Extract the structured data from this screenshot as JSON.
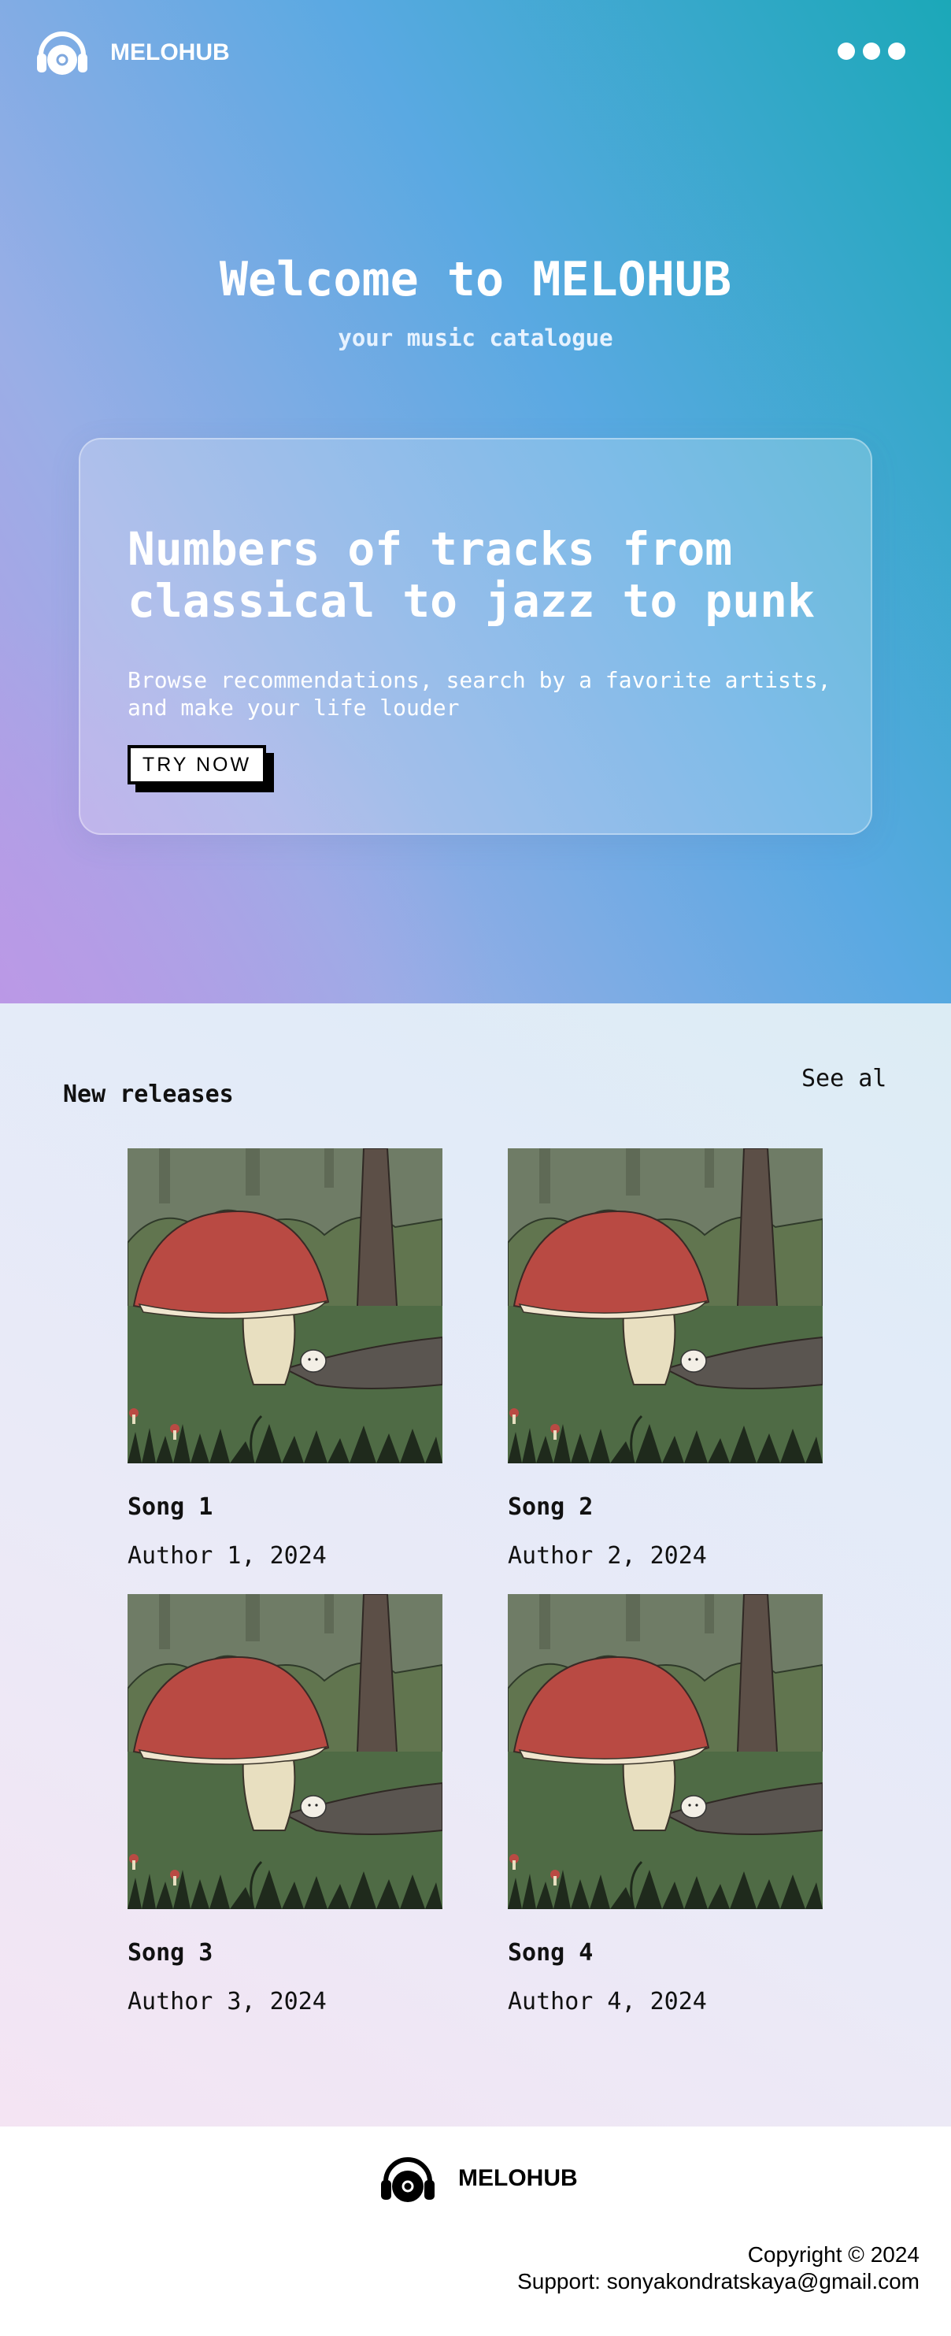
{
  "header": {
    "logo_text": "MELOHUB",
    "logo_icon": "headphones-record-icon",
    "menu_icon": "more-dots-icon"
  },
  "hero": {
    "title": "Welcome to MELOHUB",
    "subtitle": "your music catalogue"
  },
  "promo": {
    "title": "Numbers of tracks from classical to jazz to punk",
    "text": "Browse recommendations, search by a favorite artists, and make your life louder",
    "button_label": "TRY NOW"
  },
  "releases": {
    "title": "New releases",
    "see_all_label": "See al",
    "items": [
      {
        "title": "Song 1",
        "meta": "Author 1, 2024",
        "cover": "mushroom-illustration"
      },
      {
        "title": "Song 2",
        "meta": "Author 2, 2024",
        "cover": "mushroom-illustration"
      },
      {
        "title": "Song 3",
        "meta": "Author 3, 2024",
        "cover": "mushroom-illustration"
      },
      {
        "title": "Song 4",
        "meta": "Author 4, 2024",
        "cover": "mushroom-illustration"
      }
    ]
  },
  "footer": {
    "logo_text": "MELOHUB",
    "copyright": "Copyright © 2024",
    "support": "Support: sonyakondratskaya@gmail.com"
  },
  "colors": {
    "hero_gradient_start": "#b79be6",
    "hero_gradient_end": "#1ba8b8",
    "mushroom_cap": "#b94a43",
    "forest_green": "#4f6b45"
  }
}
